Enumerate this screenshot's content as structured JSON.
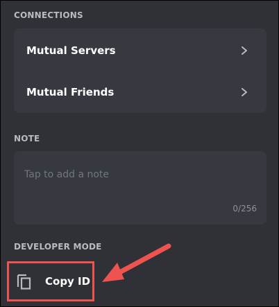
{
  "connections": {
    "heading": "CONNECTIONS",
    "items": [
      {
        "label": "Mutual Servers",
        "icon": "chevron-right-icon"
      },
      {
        "label": "Mutual Friends",
        "icon": "chevron-right-icon"
      }
    ]
  },
  "note": {
    "heading": "NOTE",
    "placeholder": "Tap to add a note",
    "counter": "0/256"
  },
  "developer_mode": {
    "heading": "DEVELOPER MODE",
    "copy_id_label": "Copy ID",
    "icon": "copy-icon"
  },
  "colors": {
    "background": "#2f3136",
    "card": "#36393f",
    "heading_text": "#b9bbbe",
    "highlight": "#ef5350"
  }
}
